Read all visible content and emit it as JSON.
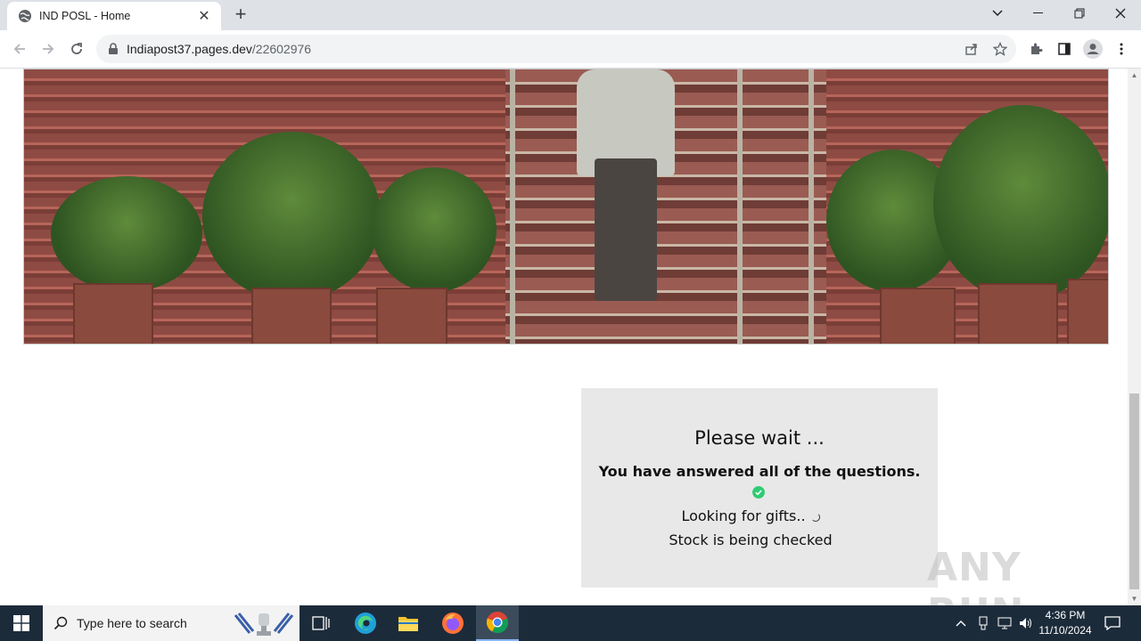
{
  "browser": {
    "tab_title": "IND POSL - Home",
    "url_host": "Indiapost37.pages.dev",
    "url_path": "/22602976"
  },
  "page": {
    "wait_title": "Please wait ...",
    "answered_text": "You have answered all of the questions.",
    "looking_text": "Looking for gifts..",
    "stock_text": "Stock is being checked",
    "watermark": "ANY RUN",
    "accent_check": "#2ecc71"
  },
  "taskbar": {
    "search_placeholder": "Type here to search",
    "time": "4:36 PM",
    "date": "11/10/2024"
  }
}
